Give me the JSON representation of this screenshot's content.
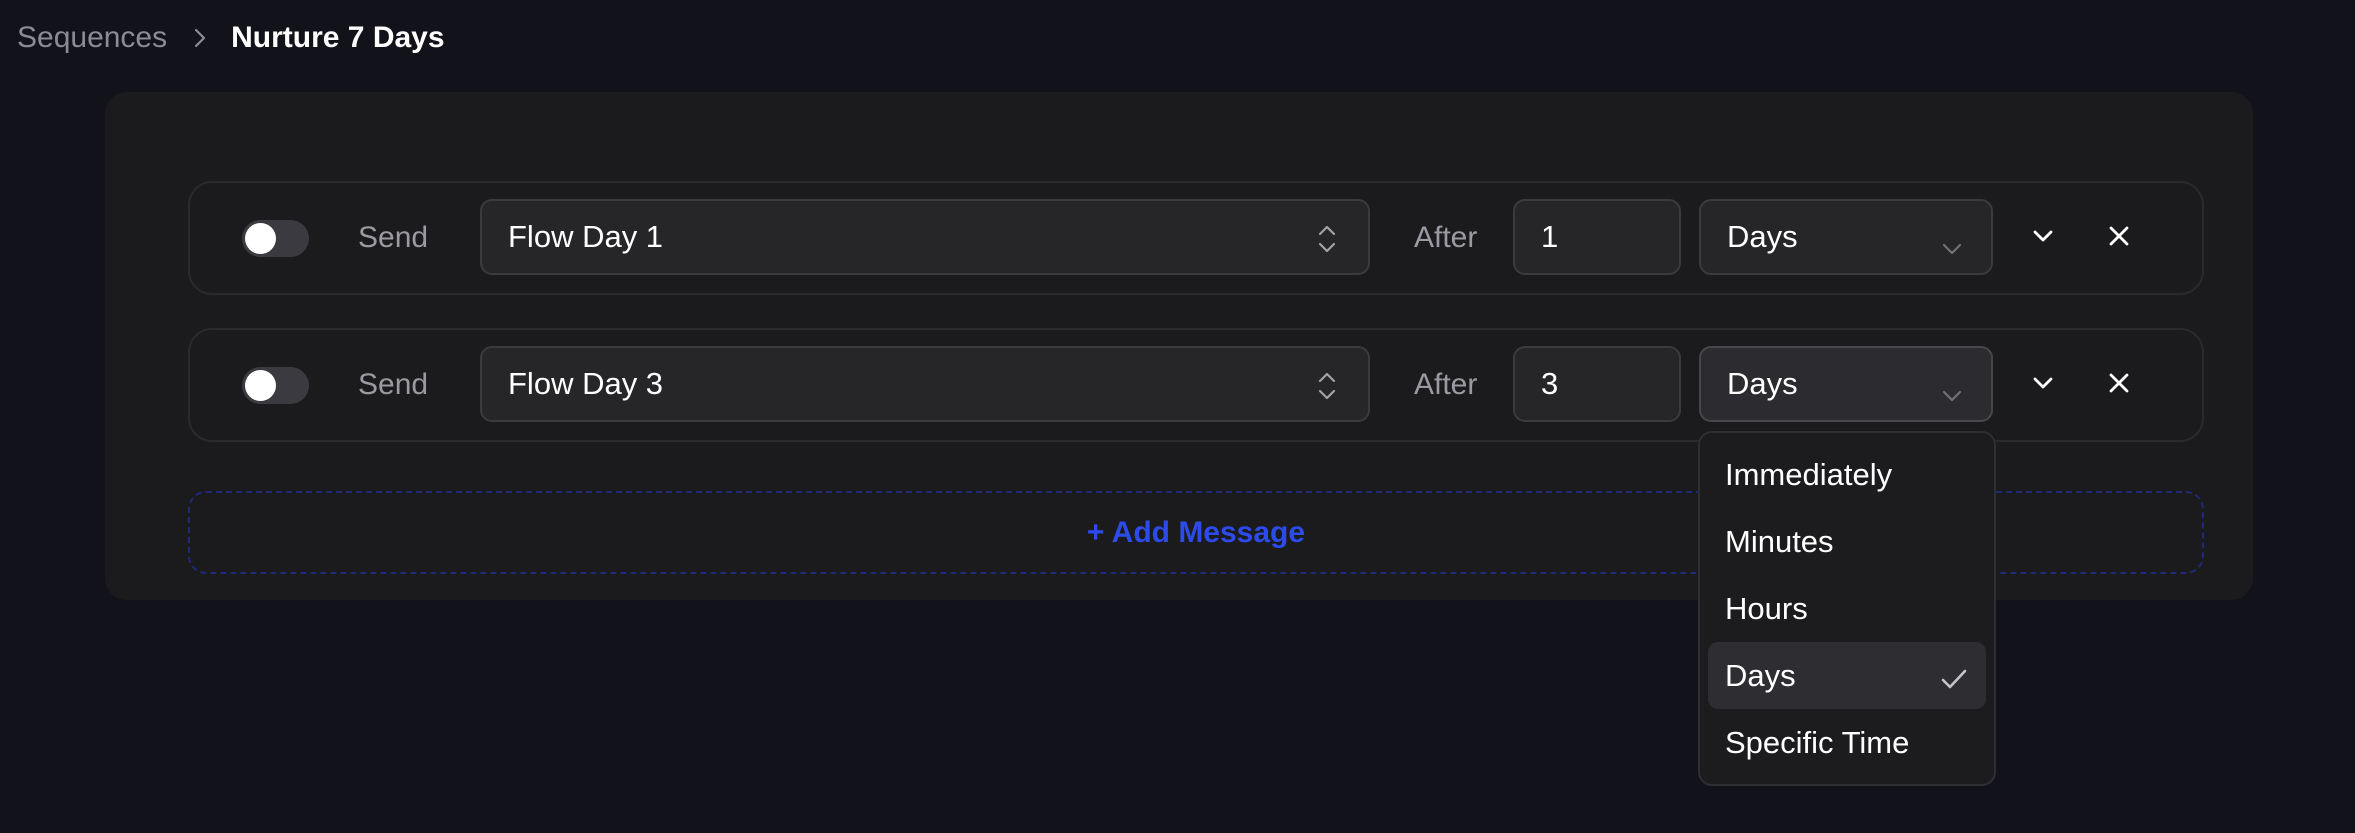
{
  "breadcrumb": {
    "parent": "Sequences",
    "current": "Nurture 7 Days"
  },
  "rows": [
    {
      "send_label": "Send",
      "message": "Flow Day 1",
      "after_label": "After",
      "delay_value": "1",
      "delay_unit": "Days",
      "enabled": false
    },
    {
      "send_label": "Send",
      "message": "Flow Day 3",
      "after_label": "After",
      "delay_value": "3",
      "delay_unit": "Days",
      "enabled": false
    }
  ],
  "add_message_label": "+ Add Message",
  "unit_dropdown": {
    "options": [
      "Immediately",
      "Minutes",
      "Hours",
      "Days",
      "Specific Time"
    ],
    "selected": "Days"
  },
  "icons": {
    "breadcrumb_separator": "chevron-right-icon",
    "message_select": "chevron-up-down-icon",
    "unit_select": "chevron-down-icon",
    "expand": "chevron-down-icon",
    "remove": "close-icon",
    "selected_option": "check-icon"
  },
  "colors": {
    "background": "#12121a",
    "panel": "#1b1b1d",
    "accent": "#2c4bea",
    "muted_text": "#9a9aa3"
  }
}
